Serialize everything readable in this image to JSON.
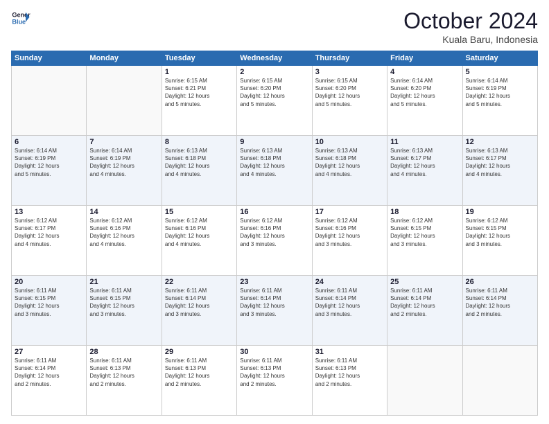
{
  "logo": {
    "line1": "General",
    "line2": "Blue"
  },
  "title": "October 2024",
  "location": "Kuala Baru, Indonesia",
  "weekdays": [
    "Sunday",
    "Monday",
    "Tuesday",
    "Wednesday",
    "Thursday",
    "Friday",
    "Saturday"
  ],
  "weeks": [
    [
      {
        "day": "",
        "info": ""
      },
      {
        "day": "",
        "info": ""
      },
      {
        "day": "1",
        "info": "Sunrise: 6:15 AM\nSunset: 6:21 PM\nDaylight: 12 hours\nand 5 minutes."
      },
      {
        "day": "2",
        "info": "Sunrise: 6:15 AM\nSunset: 6:20 PM\nDaylight: 12 hours\nand 5 minutes."
      },
      {
        "day": "3",
        "info": "Sunrise: 6:15 AM\nSunset: 6:20 PM\nDaylight: 12 hours\nand 5 minutes."
      },
      {
        "day": "4",
        "info": "Sunrise: 6:14 AM\nSunset: 6:20 PM\nDaylight: 12 hours\nand 5 minutes."
      },
      {
        "day": "5",
        "info": "Sunrise: 6:14 AM\nSunset: 6:19 PM\nDaylight: 12 hours\nand 5 minutes."
      }
    ],
    [
      {
        "day": "6",
        "info": "Sunrise: 6:14 AM\nSunset: 6:19 PM\nDaylight: 12 hours\nand 5 minutes."
      },
      {
        "day": "7",
        "info": "Sunrise: 6:14 AM\nSunset: 6:19 PM\nDaylight: 12 hours\nand 4 minutes."
      },
      {
        "day": "8",
        "info": "Sunrise: 6:13 AM\nSunset: 6:18 PM\nDaylight: 12 hours\nand 4 minutes."
      },
      {
        "day": "9",
        "info": "Sunrise: 6:13 AM\nSunset: 6:18 PM\nDaylight: 12 hours\nand 4 minutes."
      },
      {
        "day": "10",
        "info": "Sunrise: 6:13 AM\nSunset: 6:18 PM\nDaylight: 12 hours\nand 4 minutes."
      },
      {
        "day": "11",
        "info": "Sunrise: 6:13 AM\nSunset: 6:17 PM\nDaylight: 12 hours\nand 4 minutes."
      },
      {
        "day": "12",
        "info": "Sunrise: 6:13 AM\nSunset: 6:17 PM\nDaylight: 12 hours\nand 4 minutes."
      }
    ],
    [
      {
        "day": "13",
        "info": "Sunrise: 6:12 AM\nSunset: 6:17 PM\nDaylight: 12 hours\nand 4 minutes."
      },
      {
        "day": "14",
        "info": "Sunrise: 6:12 AM\nSunset: 6:16 PM\nDaylight: 12 hours\nand 4 minutes."
      },
      {
        "day": "15",
        "info": "Sunrise: 6:12 AM\nSunset: 6:16 PM\nDaylight: 12 hours\nand 4 minutes."
      },
      {
        "day": "16",
        "info": "Sunrise: 6:12 AM\nSunset: 6:16 PM\nDaylight: 12 hours\nand 3 minutes."
      },
      {
        "day": "17",
        "info": "Sunrise: 6:12 AM\nSunset: 6:16 PM\nDaylight: 12 hours\nand 3 minutes."
      },
      {
        "day": "18",
        "info": "Sunrise: 6:12 AM\nSunset: 6:15 PM\nDaylight: 12 hours\nand 3 minutes."
      },
      {
        "day": "19",
        "info": "Sunrise: 6:12 AM\nSunset: 6:15 PM\nDaylight: 12 hours\nand 3 minutes."
      }
    ],
    [
      {
        "day": "20",
        "info": "Sunrise: 6:11 AM\nSunset: 6:15 PM\nDaylight: 12 hours\nand 3 minutes."
      },
      {
        "day": "21",
        "info": "Sunrise: 6:11 AM\nSunset: 6:15 PM\nDaylight: 12 hours\nand 3 minutes."
      },
      {
        "day": "22",
        "info": "Sunrise: 6:11 AM\nSunset: 6:14 PM\nDaylight: 12 hours\nand 3 minutes."
      },
      {
        "day": "23",
        "info": "Sunrise: 6:11 AM\nSunset: 6:14 PM\nDaylight: 12 hours\nand 3 minutes."
      },
      {
        "day": "24",
        "info": "Sunrise: 6:11 AM\nSunset: 6:14 PM\nDaylight: 12 hours\nand 3 minutes."
      },
      {
        "day": "25",
        "info": "Sunrise: 6:11 AM\nSunset: 6:14 PM\nDaylight: 12 hours\nand 2 minutes."
      },
      {
        "day": "26",
        "info": "Sunrise: 6:11 AM\nSunset: 6:14 PM\nDaylight: 12 hours\nand 2 minutes."
      }
    ],
    [
      {
        "day": "27",
        "info": "Sunrise: 6:11 AM\nSunset: 6:14 PM\nDaylight: 12 hours\nand 2 minutes."
      },
      {
        "day": "28",
        "info": "Sunrise: 6:11 AM\nSunset: 6:13 PM\nDaylight: 12 hours\nand 2 minutes."
      },
      {
        "day": "29",
        "info": "Sunrise: 6:11 AM\nSunset: 6:13 PM\nDaylight: 12 hours\nand 2 minutes."
      },
      {
        "day": "30",
        "info": "Sunrise: 6:11 AM\nSunset: 6:13 PM\nDaylight: 12 hours\nand 2 minutes."
      },
      {
        "day": "31",
        "info": "Sunrise: 6:11 AM\nSunset: 6:13 PM\nDaylight: 12 hours\nand 2 minutes."
      },
      {
        "day": "",
        "info": ""
      },
      {
        "day": "",
        "info": ""
      }
    ]
  ]
}
